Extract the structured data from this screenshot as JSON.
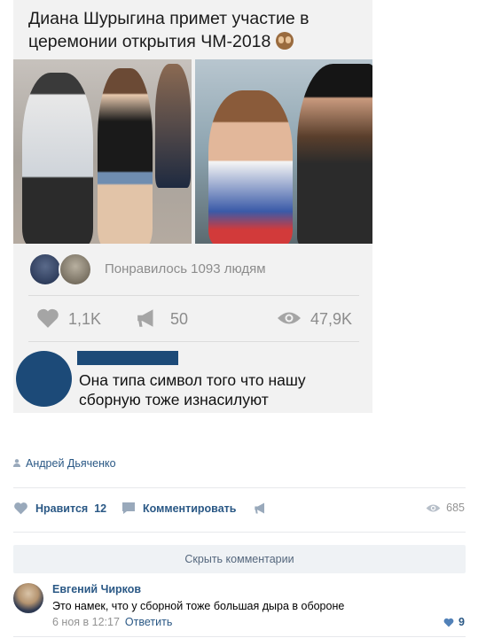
{
  "meme": {
    "title": "Диана Шурыгина примет участие в церемонии открытия ЧМ-2018",
    "liked_text": "Понравилось 1093 людям",
    "likes": "1,1K",
    "reposts": "50",
    "views": "47,9K",
    "comment_text": "Она типа символ того что нашу сборную тоже изнасилуют"
  },
  "post": {
    "author": "Андрей Дьяченко",
    "like_label": "Нравится",
    "like_count": "12",
    "comment_label": "Комментировать",
    "views": "685"
  },
  "comments": {
    "hide_label": "Скрыть комментарии",
    "items": [
      {
        "author": "Евгений Чирков",
        "text": "Это намек, что у сборной тоже большая дыра в обороне",
        "date": "6 ноя в 12:17",
        "reply_label": "Ответить",
        "likes": "9"
      }
    ]
  },
  "colors": {
    "link": "#2a5885",
    "muted": "#939393",
    "censor_blue": "#1c4a78"
  }
}
